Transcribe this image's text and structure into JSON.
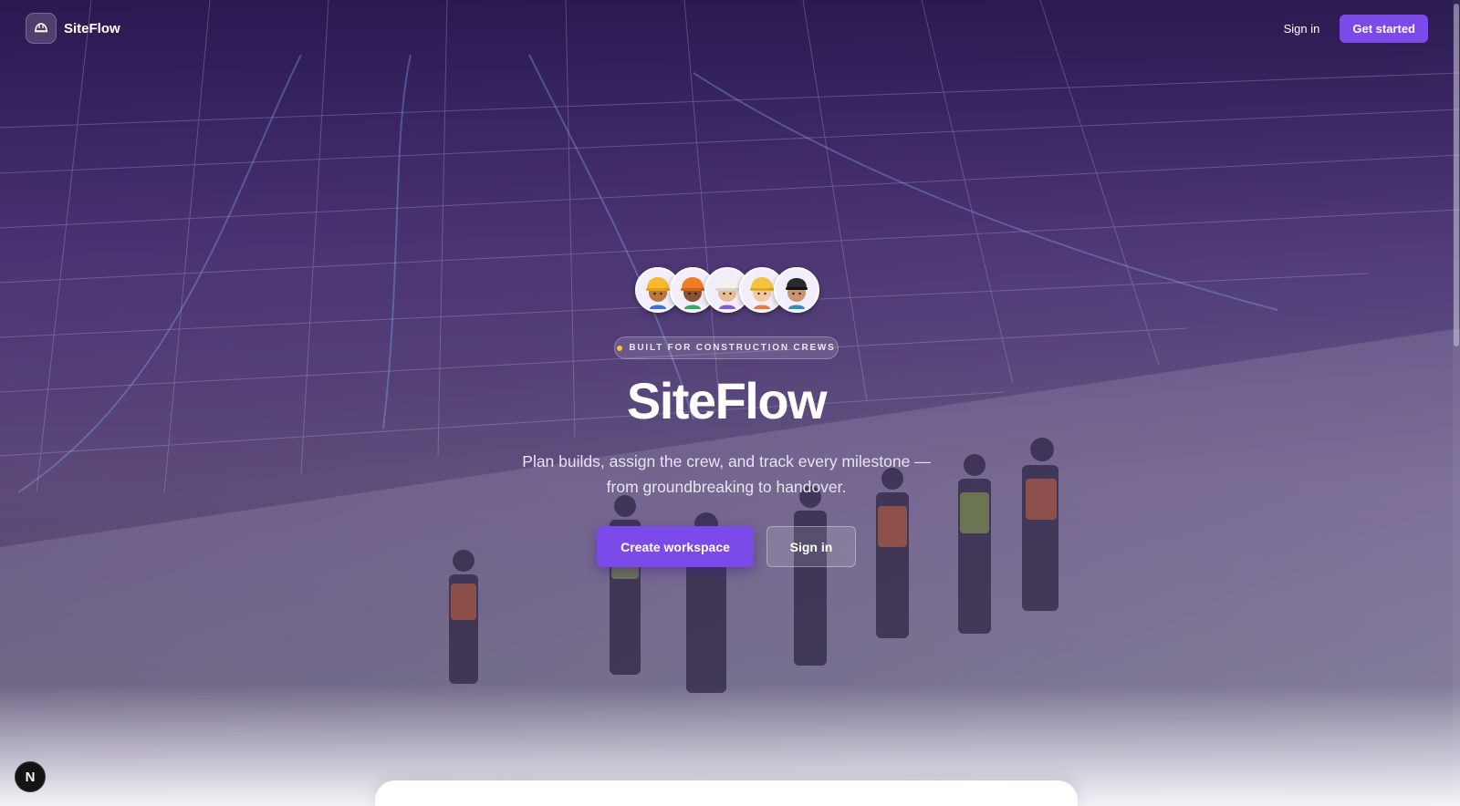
{
  "nav": {
    "brand": "SiteFlow",
    "sign_in": "Sign in",
    "get_started": "Get started",
    "logo_icon": "hard-hat-icon"
  },
  "hero": {
    "badge": "BUILT FOR CONSTRUCTION CREWS",
    "title": "SiteFlow",
    "subtitle_line1": "Plan builds, assign the crew, and track every milestone —",
    "subtitle_line2": "from groundbreaking to handover.",
    "primary_cta": "Create workspace",
    "secondary_cta": "Sign in",
    "avatars": [
      {
        "icon": "construction-worker-yellow-helmet-icon",
        "helmet": "#f5b82e",
        "skin": "#b8773f"
      },
      {
        "icon": "construction-worker-orange-helmet-icon",
        "helmet": "#ef7d22",
        "skin": "#8a5232"
      },
      {
        "icon": "construction-worker-white-helmet-icon",
        "helmet": "#f4f1ec",
        "skin": "#e6bd94"
      },
      {
        "icon": "construction-worker-yellow-helmet-icon",
        "helmet": "#f5c242",
        "skin": "#f0c8a4"
      },
      {
        "icon": "worker-black-cap-icon",
        "helmet": "#2a2a2a",
        "skin": "#c99470"
      }
    ]
  },
  "dev_badge": "N",
  "colors": {
    "accent": "#7c4ae8",
    "badge_dot": "#f5c242"
  }
}
